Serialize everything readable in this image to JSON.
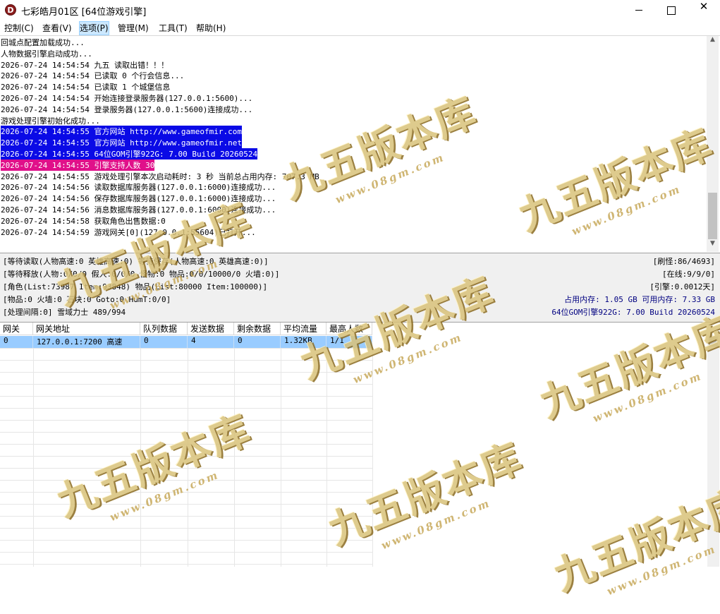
{
  "window": {
    "title": "七彩皓月01区 [64位游戏引擎]",
    "icon_letter": "D",
    "controls": {
      "minimize": "—",
      "maximize": "",
      "close": "✕"
    }
  },
  "menu": [
    {
      "label": "控制(C)"
    },
    {
      "label": "查看(V)"
    },
    {
      "label": "选项(P)",
      "active": true
    },
    {
      "label": "管理(M)"
    },
    {
      "label": "工具(T)"
    },
    {
      "label": "帮助(H)"
    }
  ],
  "log": [
    {
      "text": "回城点配置加载成功...",
      "style": "normal"
    },
    {
      "text": "人物数据引擎启动成功...",
      "style": "normal"
    },
    {
      "text": "2026-07-24 14:54:54 九五 读取出错！！！",
      "style": "normal"
    },
    {
      "text": "2026-07-24 14:54:54 已读取 0 个行会信息...",
      "style": "normal"
    },
    {
      "text": "2026-07-24 14:54:54 已读取 1 个城堡信息",
      "style": "normal"
    },
    {
      "text": "2026-07-24 14:54:54 开始连接登录服务器(127.0.0.1:5600)...",
      "style": "normal"
    },
    {
      "text": "2026-07-24 14:54:54 登录服务器(127.0.0.1:5600)连接成功...",
      "style": "normal"
    },
    {
      "text": "游戏处理引擎初始化成功...",
      "style": "normal"
    },
    {
      "text": "2026-07-24 14:54:55 官方网站 http://www.gameofmir.com",
      "style": "blue"
    },
    {
      "text": "2026-07-24 14:54:55 官方网站 http://www.gameofmir.net",
      "style": "blue"
    },
    {
      "text": "2026-07-24 14:54:55 64位GOM引擎922G: 7.00 Build 20260524",
      "style": "blue"
    },
    {
      "text": "2026-07-24 14:54:55 引擎支持人数 30",
      "style": "magenta"
    },
    {
      "text": "2026-07-24 14:54:55 游戏处理引擎本次启动耗时: 3 秒 当前总占用内存: 707.3 MB",
      "style": "normal"
    },
    {
      "text": "2026-07-24 14:54:56 读取数据库服务器(127.0.0.1:6000)连接成功...",
      "style": "normal"
    },
    {
      "text": "2026-07-24 14:54:56 保存数据库服务器(127.0.0.1:6000)连接成功...",
      "style": "normal"
    },
    {
      "text": "2026-07-24 14:54:56 消息数据库服务器(127.0.0.1:6000)连接成功...",
      "style": "normal"
    },
    {
      "text": "2026-07-24 14:54:58 获取角色出售数据:0",
      "style": "normal"
    },
    {
      "text": "2026-07-24 14:54:59 游戏网关[0](127.0.0.1:55604)已打开...",
      "style": "normal"
    }
  ],
  "status": {
    "left": [
      "[等待读取(人物高速:0 英雄高速:0) 等待保存(人物高速:0 英雄高速:0)]",
      "[等待释放(人物:0/0/0 假人:0/0/0 怪物:0 物品:0/0/10000/0 火墙:0)]",
      "[角色(List:73987 Item:93848) 物品(List:80000 Item:100000)]",
      "[物品:0 火墙:0 石块:0 Goto:0 HumT:0/0]",
      "[处理间隔:0] 雪域力士 489/994"
    ],
    "right": [
      "[刷怪:86/4693]",
      "[在线:9/9/0]",
      "[引擎:0.0012天]",
      "占用内存: 1.05 GB 可用内存: 7.33 GB",
      "64位GOM引擎922G: 7.00 Build 20260524"
    ]
  },
  "grid": {
    "columns": [
      "网关",
      "网关地址",
      "队列数据",
      "发送数据",
      "剩余数据",
      "平均流量",
      "最高人数"
    ],
    "rows": [
      [
        "0",
        "127.0.0.1:7200 高速",
        "0",
        "4",
        "0",
        "1.32KB",
        "1/1"
      ]
    ]
  },
  "watermark": {
    "main": "九五版本库",
    "url": "www.08gm.com"
  }
}
